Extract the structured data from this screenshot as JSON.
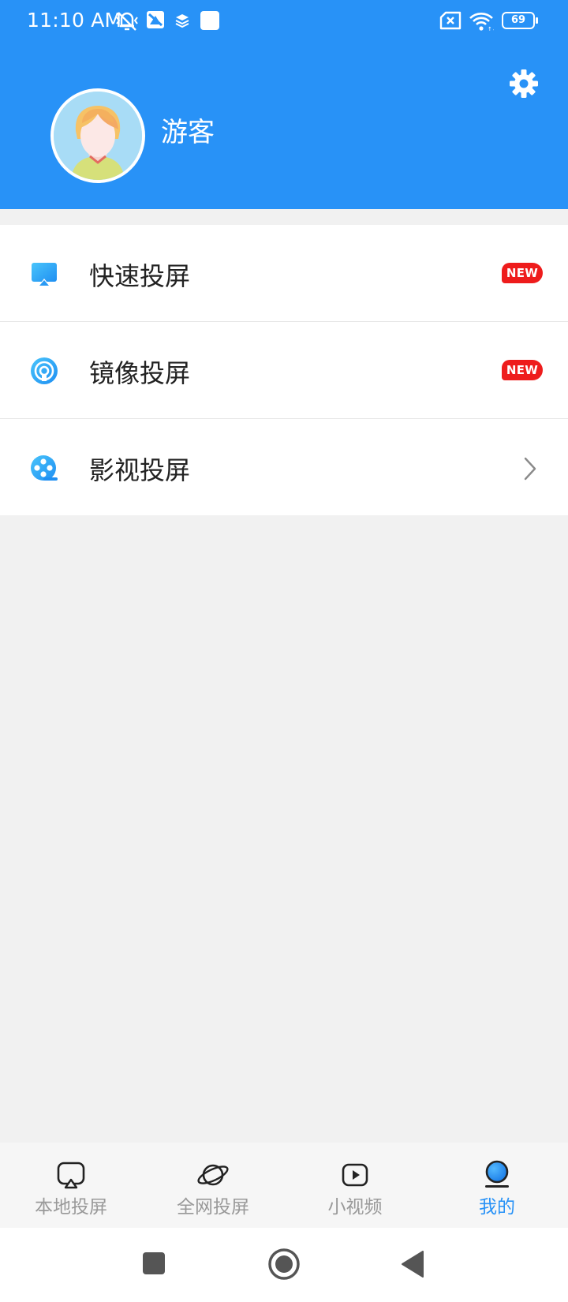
{
  "status_bar": {
    "time": "11:10 AM",
    "battery": "69",
    "icons": [
      "mute-vibrate-icon",
      "app-notification-icon",
      "layers-icon",
      "blank-notification-icon",
      "no-sim-icon",
      "wifi-icon",
      "battery-icon"
    ]
  },
  "header": {
    "username": "游客",
    "settings_icon": "gear-icon",
    "background": "#2892f7"
  },
  "menu": {
    "items": [
      {
        "label": "快速投屏",
        "icon": "airplay-screen-icon",
        "badge": "NEW"
      },
      {
        "label": "镜像投屏",
        "icon": "broadcast-signal-icon",
        "badge": "NEW"
      },
      {
        "label": "影视投屏",
        "icon": "film-reel-icon",
        "trailing": "chevron-right-icon"
      }
    ]
  },
  "tabs": {
    "items": [
      {
        "label": "本地投屏",
        "icon": "cast-screen-icon",
        "active": false
      },
      {
        "label": "全网投屏",
        "icon": "planet-icon",
        "active": false
      },
      {
        "label": "小视频",
        "icon": "play-video-icon",
        "active": false
      },
      {
        "label": "我的",
        "icon": "profile-icon",
        "active": true
      }
    ],
    "active_color": "#2892f7",
    "inactive_color": "#999999"
  },
  "nav": {
    "buttons": [
      "recents-square-icon",
      "home-circle-icon",
      "back-triangle-icon"
    ]
  },
  "colors": {
    "accent": "#2892f7",
    "badge_red": "#ee1c1c",
    "page_background": "#f1f1f1"
  }
}
